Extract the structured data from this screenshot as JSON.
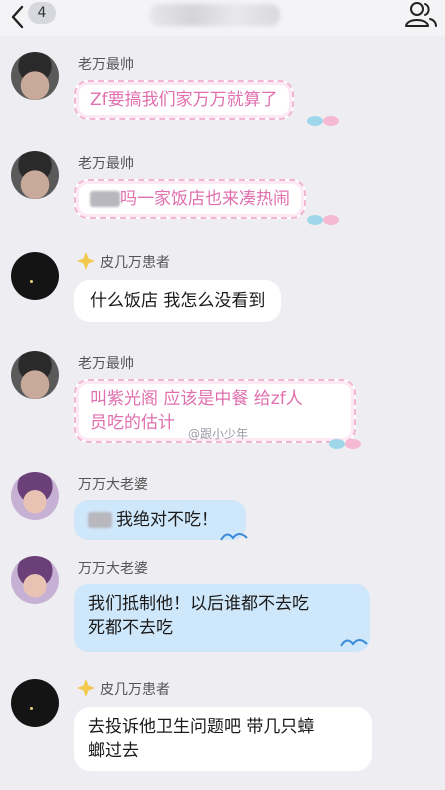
{
  "header": {
    "unread_count": "4"
  },
  "messages": [
    {
      "sender": "老万最帅",
      "text": "Zf要搞我们家万万就算了"
    },
    {
      "sender": "老万最帅",
      "text": "吗一家饭店也来凑热闹"
    },
    {
      "sender": "皮几万患者",
      "text": "什么饭店 我怎么没看到"
    },
    {
      "sender": "老万最帅",
      "text_line1": "叫紫光阁 应该是中餐 给zf人",
      "text_line2": "员吃的估计",
      "watermark": "@跟小少年"
    },
    {
      "sender": "万万大老婆",
      "text": "我绝对不吃！"
    },
    {
      "sender": "万万大老婆",
      "text_line1": "我们抵制他！以后谁都不去吃",
      "text_line2": "死都不去吃"
    },
    {
      "sender": "皮几万患者",
      "text_line1": "去投诉他卫生问题吧 带几只蟑",
      "text_line2": "螂过去"
    }
  ],
  "colors": {
    "pink_text": "#e06fae",
    "blue_bubble": "#cfe7fa",
    "background": "#eeeef2"
  }
}
